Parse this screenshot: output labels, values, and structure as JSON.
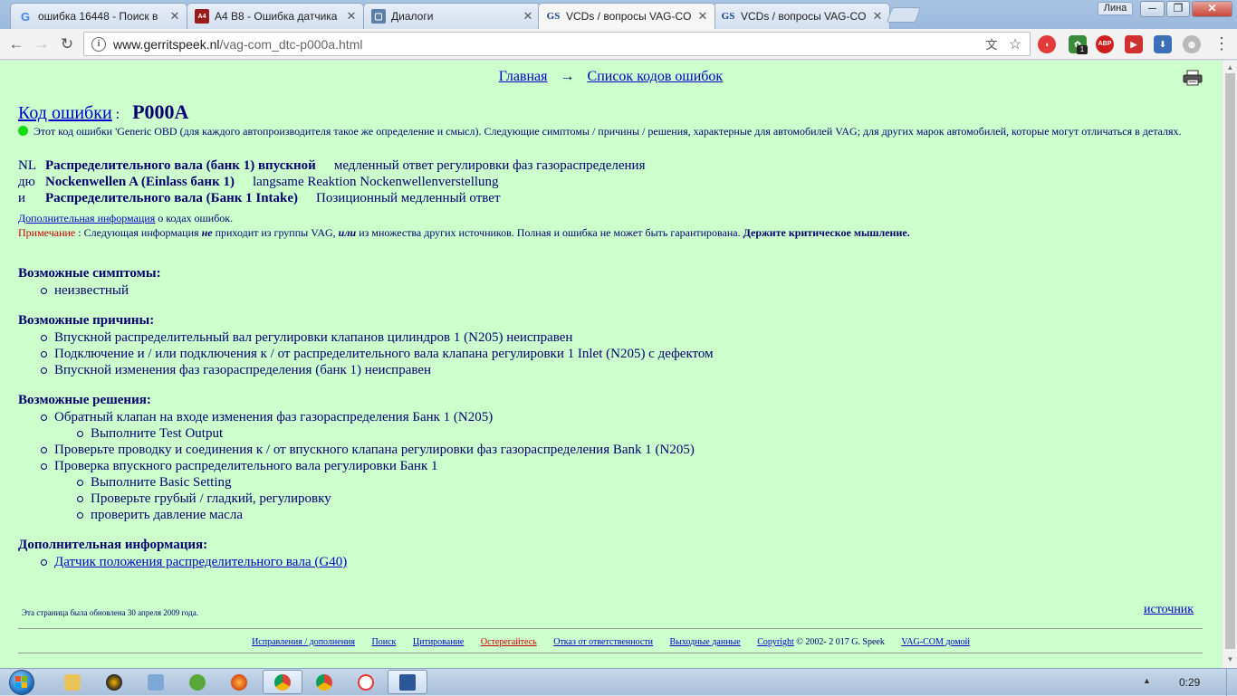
{
  "browser": {
    "tabs": [
      {
        "title": "ошибка 16448 - Поиск в",
        "favicon": "google-g-icon"
      },
      {
        "title": "A4 B8 - Ошибка датчика",
        "favicon": "audi-club-icon"
      },
      {
        "title": "Диалоги",
        "favicon": "vk-dialog-icon"
      },
      {
        "title": "VCDs / вопросы VAG-CO",
        "favicon": "gs-icon",
        "active": true
      },
      {
        "title": "VCDs / вопросы VAG-CO",
        "favicon": "gs-icon"
      }
    ],
    "user_name": "Лина",
    "url_host": "www.gerritspeek.nl",
    "url_path": "/vag-com_dtc-p000a.html",
    "extension_badge": "1"
  },
  "page": {
    "nav": {
      "home": "Главная",
      "arrow": "→",
      "list": "Список кодов ошибок"
    },
    "code_label": "Код ошибки",
    "code_sep": ":",
    "code": "P000A",
    "generic_note": "Этот код ошибки 'Generic OBD (для каждого автопроизводителя такое же определение и смысл). Следующие симптомы / причины / решения, характерные для автомобилей VAG; для других марок автомобилей, которые могут отличаться в деталях.",
    "descriptions": [
      {
        "lang": "NL",
        "name": "Распределительного вала (банк 1) впускной",
        "text": "медленный ответ регулировки фаз газораспределения"
      },
      {
        "lang": "дю",
        "name": "Nockenwellen A (Einlass банк 1)",
        "text": "langsame Reaktion Nockenwellenverstellung"
      },
      {
        "lang": "и",
        "name": "Распределительного вала (Банк 1 Intake)",
        "text": "Позиционный медленный ответ"
      }
    ],
    "more_info_link": "Дополнительная информация",
    "more_info_rest": " о кодах ошибок.",
    "note_label": "Примечание",
    "note_sep": " : ",
    "note_a": "Следующая информация ",
    "note_b": "не",
    "note_c": " приходит из группы VAG, ",
    "note_d": "или",
    "note_e": " из множества других источников. Полная и ошибка не может быть гарантирована. ",
    "note_f": "Держите критическое мышление.",
    "symptoms_h": "Возможные симптомы:",
    "symptoms": [
      "неизвестный"
    ],
    "causes_h": "Возможные причины:",
    "causes": [
      "Впускной распределительный вал регулировки клапанов цилиндров 1 (N205) неисправен",
      "Подключение и / или подключения к / от распределительного вала клапана регулировки 1 Inlet (N205) с дефектом",
      "Впускной изменения фаз газораспределения (банк 1) неисправен"
    ],
    "solutions_h": "Возможные решения:",
    "solutions": [
      {
        "text": "Обратный клапан на входе изменения фаз газораспределения Банк 1 (N205)",
        "sub": false
      },
      {
        "text": "Выполните Test Output",
        "sub": true
      },
      {
        "text": "Проверьте проводку и соединения к / от впускного клапана регулировки фаз газораспределения Bank 1 (N205)",
        "sub": false
      },
      {
        "text": "Проверка впускного распределительного вала регулировки Банк 1",
        "sub": false
      },
      {
        "text": "Выполните Basic Setting",
        "sub": true
      },
      {
        "text": "Проверьте грубый / гладкий, регулировку",
        "sub": true
      },
      {
        "text": "проверить давление масла",
        "sub": true
      }
    ],
    "extra_h": "Дополнительная информация:",
    "extra": [
      "Датчик положения распределительного вала (G40)"
    ],
    "updated": "Эта страница была обновлена 30 апреля 2009 года.",
    "source": "источник",
    "footer": {
      "corrections": "Исправления / дополнения",
      "search": "Поиск",
      "citation": "Цитирование",
      "beware": "Остерегайтесь",
      "disclaimer": "Отказ от ответственности",
      "imprint": "Выходные данные",
      "copyright_link": "Copyright",
      "copyright_text": " © 2002- 2 017 G. Speek",
      "home": "VAG-COM домой"
    }
  },
  "taskbar": {
    "clock": "0:29"
  }
}
